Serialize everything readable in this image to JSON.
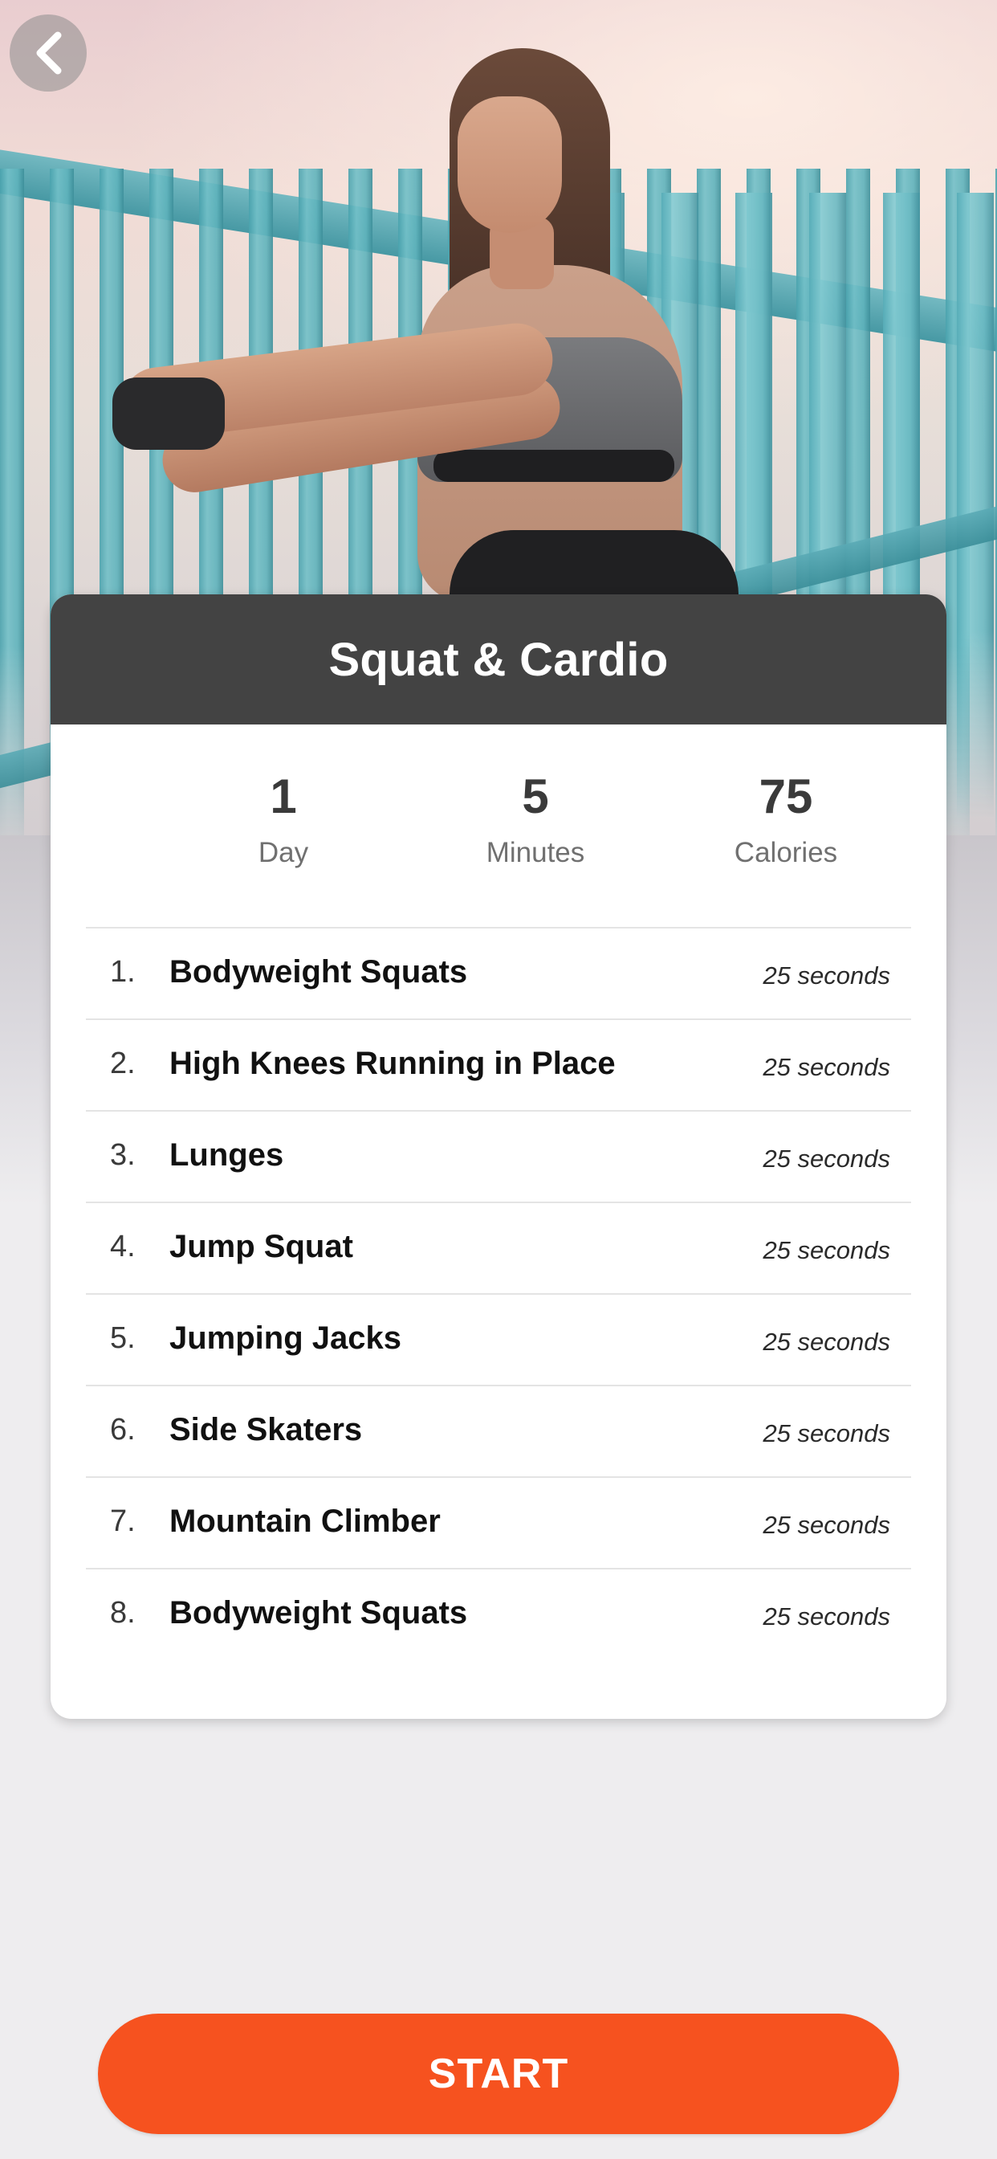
{
  "theme": {
    "accent": "#F6521F",
    "header_bg": "#434343",
    "page_bg": "#EEEDEF"
  },
  "hero": {
    "image": "woman-stretching-on-bridge-photo"
  },
  "nav": {
    "back_icon": "chevron-left-icon"
  },
  "workout": {
    "title": "Squat & Cardio",
    "stats": [
      {
        "value": "1",
        "label": "Day"
      },
      {
        "value": "5",
        "label": "Minutes"
      },
      {
        "value": "75",
        "label": "Calories"
      }
    ],
    "exercises": [
      {
        "number": "1.",
        "name": "Bodyweight Squats",
        "duration": "25 seconds"
      },
      {
        "number": "2.",
        "name": "High Knees Running in Place",
        "duration": "25 seconds"
      },
      {
        "number": "3.",
        "name": "Lunges",
        "duration": "25 seconds"
      },
      {
        "number": "4.",
        "name": "Jump Squat",
        "duration": "25 seconds"
      },
      {
        "number": "5.",
        "name": "Jumping Jacks",
        "duration": "25 seconds"
      },
      {
        "number": "6.",
        "name": "Side Skaters",
        "duration": "25 seconds"
      },
      {
        "number": "7.",
        "name": "Mountain Climber",
        "duration": "25 seconds"
      },
      {
        "number": "8.",
        "name": "Bodyweight Squats",
        "duration": "25 seconds"
      }
    ]
  },
  "start_button": {
    "label": "START"
  }
}
